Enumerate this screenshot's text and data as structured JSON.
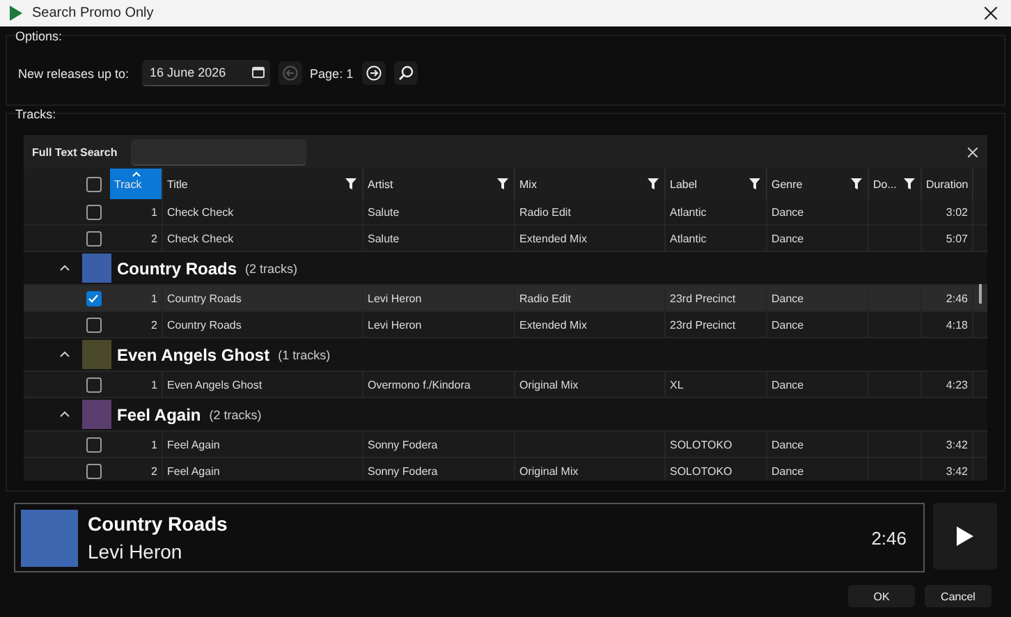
{
  "window": {
    "title": "Search Promo Only"
  },
  "options": {
    "label": "Options:",
    "release_label": "New releases up to:",
    "date": "16 June 2026",
    "prev_disabled": true,
    "page": "Page: 1"
  },
  "tracks": {
    "label": "Tracks:",
    "search_label": "Full Text Search",
    "select_all_checked": false
  },
  "columns": [
    {
      "label": "Track",
      "sorted": true,
      "filter": false
    },
    {
      "label": "Title",
      "sorted": false,
      "filter": true
    },
    {
      "label": "Artist",
      "sorted": false,
      "filter": true
    },
    {
      "label": "Mix",
      "sorted": false,
      "filter": true
    },
    {
      "label": "Label",
      "sorted": false,
      "filter": true
    },
    {
      "label": "Genre",
      "sorted": false,
      "filter": true
    },
    {
      "label": "Do...",
      "sorted": false,
      "filter": true
    },
    {
      "label": "Duration",
      "sorted": false,
      "filter": false
    }
  ],
  "groups": [
    {
      "rows": [
        {
          "cells": [
            "1",
            "Check Check",
            "Salute",
            "Radio Edit",
            "Atlantic",
            "Dance",
            "",
            "3:02"
          ],
          "checked": false,
          "selected": false
        },
        {
          "cells": [
            "2",
            "Check Check",
            "Salute",
            "Extended Mix",
            "Atlantic",
            "Dance",
            "",
            "5:07"
          ],
          "checked": false,
          "selected": false
        }
      ]
    },
    {
      "title": "Country Roads",
      "count": "(2 tracks)",
      "expanded": true,
      "color": "#3a5fa8",
      "rows": [
        {
          "cells": [
            "1",
            "Country Roads",
            "Levi Heron",
            "Radio Edit",
            "23rd Precinct",
            "Dance",
            "",
            "2:46"
          ],
          "checked": true,
          "selected": true
        },
        {
          "cells": [
            "2",
            "Country Roads",
            "Levi Heron",
            "Extended Mix",
            "23rd Precinct",
            "Dance",
            "",
            "4:18"
          ],
          "checked": false,
          "selected": false
        }
      ]
    },
    {
      "title": "Even Angels Ghost",
      "count": "(1 tracks)",
      "expanded": true,
      "color": "#4a4a2a",
      "rows": [
        {
          "cells": [
            "1",
            "Even Angels Ghost",
            "Overmono f./Kindora",
            "Original Mix",
            "XL",
            "Dance",
            "",
            "4:23"
          ],
          "checked": false,
          "selected": false
        }
      ]
    },
    {
      "title": "Feel Again",
      "count": "(2 tracks)",
      "expanded": true,
      "color": "#5a3d6e",
      "rows": [
        {
          "cells": [
            "1",
            "Feel Again",
            "Sonny Fodera",
            "",
            "SOLOTOKO",
            "Dance",
            "",
            "3:42"
          ],
          "checked": false,
          "selected": false
        },
        {
          "cells": [
            "2",
            "Feel Again",
            "Sonny Fodera",
            "Original Mix",
            "SOLOTOKO",
            "Dance",
            "",
            "3:42"
          ],
          "checked": false,
          "selected": false
        }
      ]
    }
  ],
  "player": {
    "title": "Country Roads",
    "artist": "Levi Heron",
    "time": "2:46"
  },
  "buttons": [
    "OK",
    "Cancel"
  ]
}
